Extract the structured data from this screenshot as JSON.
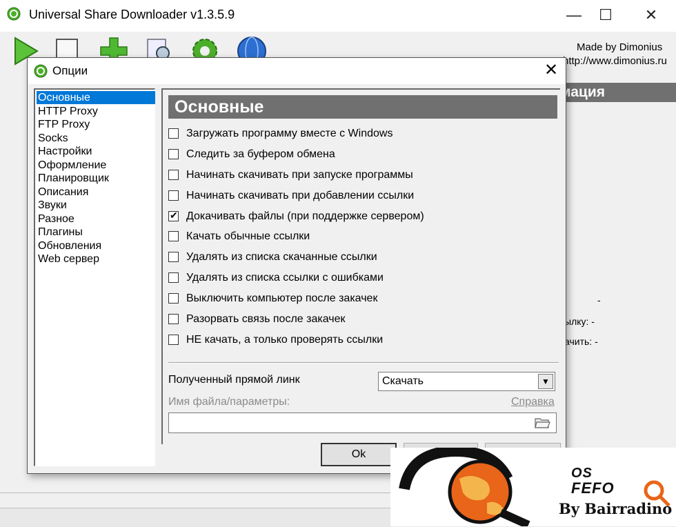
{
  "app": {
    "title": "Universal Share Downloader v1.3.5.9",
    "icon": "usd-app-icon",
    "window_controls": {
      "minimize": "—",
      "maximize": "☐",
      "close": "✕"
    },
    "made_by": "Made by Dimonius",
    "site_url": "http://www.dimonius.ru",
    "toolbar_icons": [
      "play-icon",
      "new-document-icon",
      "add-plus-icon",
      "magnifier-document-icon",
      "gear-icon",
      "globe-icon"
    ],
    "info_header": "мация",
    "info_lines": [
      "-",
      "ылку: -",
      "ачить: -"
    ]
  },
  "dialog": {
    "title": "Опции",
    "close": "✕",
    "nav_items": [
      "Основные",
      "HTTP Proxy",
      "FTP Proxy",
      "Socks",
      "Настройки",
      "Оформление",
      "Планировщик",
      "Описания",
      "Звуки",
      "Разное",
      "Плагины",
      "Обновления",
      "Web сервер"
    ],
    "selected_nav": 0,
    "section_title": "Основные",
    "options": [
      {
        "label": "Загружать программу вместе с Windows",
        "checked": false
      },
      {
        "label": "Следить за буфером обмена",
        "checked": false
      },
      {
        "label": "Начинать скачивать при запуске программы",
        "checked": false
      },
      {
        "label": "Начинать скачивать при добавлении ссылки",
        "checked": false
      },
      {
        "label": "Докачивать файлы (при поддержке сервером)",
        "checked": true
      },
      {
        "label": "Качать обычные ссылки",
        "checked": false
      },
      {
        "label": "Удалять из списка скачанные ссылки",
        "checked": false
      },
      {
        "label": "Удалять из списка ссылки с ошибками",
        "checked": false
      },
      {
        "label": "Выключить компьютер после закачек",
        "checked": false
      },
      {
        "label": "Разорвать связь после закачек",
        "checked": false
      },
      {
        "label": "НЕ качать, а только проверять ссылки",
        "checked": false
      }
    ],
    "direct_link_label": "Полученный прямой линк",
    "direct_link_value": "Скачать",
    "filename_label": "Имя файла/параметры:",
    "filename_value": "",
    "help_link": "Справка",
    "buttons": {
      "ok": "Ok",
      "button2": "",
      "button3": ""
    }
  },
  "watermark": {
    "brand_line1": "OS",
    "brand_line2": "FEFO",
    "credit": "By Bairradino"
  },
  "colors": {
    "selection": "#0078d7",
    "header_bg": "#707070",
    "dialog_bg": "#f0f0f0",
    "watermark_orange": "#e8651a"
  }
}
